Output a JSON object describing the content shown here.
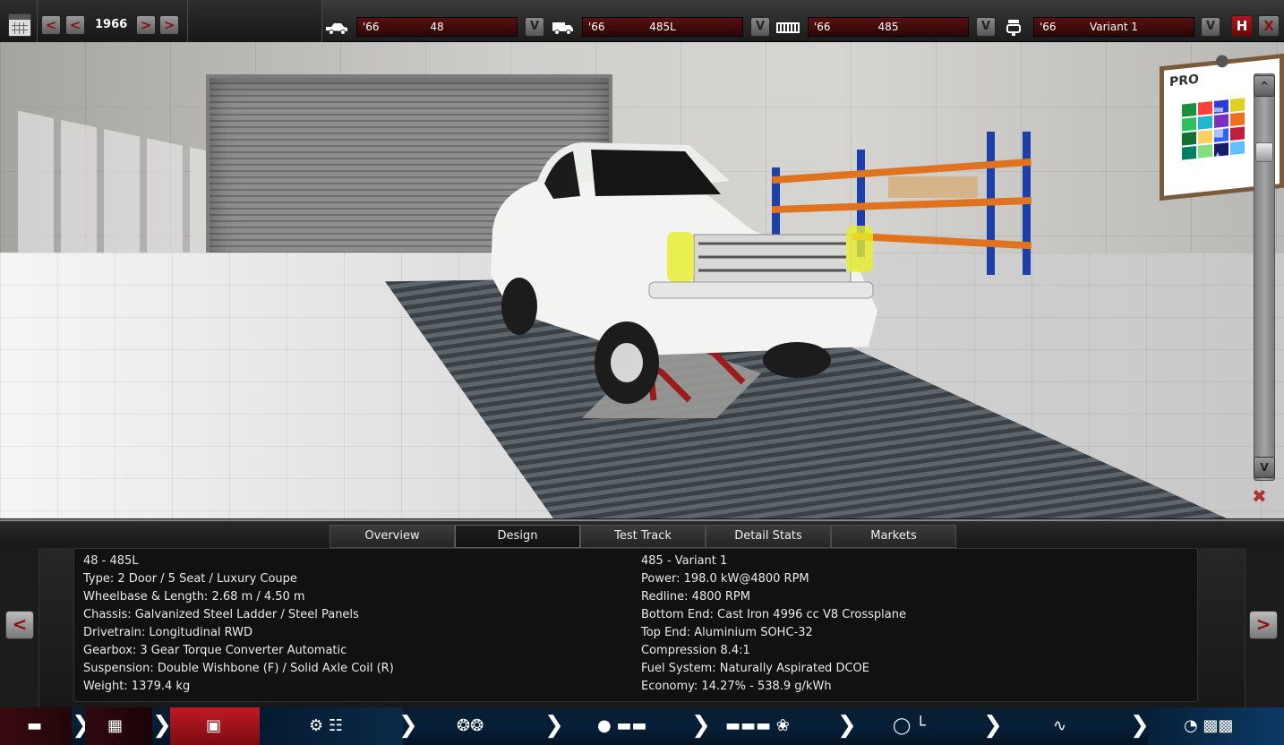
{
  "topbar": {
    "year": "1966",
    "prev_label": "<",
    "next_label": ">",
    "selectors": [
      {
        "icon": "car-model-icon",
        "year": "'66",
        "name": "48"
      },
      {
        "icon": "trim-icon",
        "year": "'66",
        "name": "485L"
      },
      {
        "icon": "engine-icon",
        "year": "'66",
        "name": "485"
      },
      {
        "icon": "engine-variant-icon",
        "year": "'66",
        "name": "Variant 1"
      }
    ],
    "dropdown_label": "V",
    "save_label": "H",
    "close_label": "X"
  },
  "scene": {
    "scroll_up": "^",
    "scroll_down": "V"
  },
  "tabs": [
    {
      "label": "Overview",
      "active": false
    },
    {
      "label": "Design",
      "active": true
    },
    {
      "label": "Test Track",
      "active": false
    },
    {
      "label": "Detail Stats",
      "active": false
    },
    {
      "label": "Markets",
      "active": false
    }
  ],
  "info": {
    "left": [
      "48 - 485L",
      "Type: 2 Door / 5 Seat / Luxury Coupe",
      "Wheelbase & Length: 2.68 m / 4.50 m",
      "Chassis: Galvanized Steel Ladder / Steel Panels",
      "Drivetrain: Longitudinal RWD",
      "Gearbox: 3 Gear Torque Converter Automatic",
      "Suspension: Double Wishbone (F) / Solid Axle Coil (R)",
      "Weight: 1379.4 kg"
    ],
    "right": [
      "485 - Variant 1",
      "Power: 198.0 kW@4800 RPM",
      "Redline: 4800 RPM",
      "Bottom End: Cast Iron 4996 cc V8 Crossplane",
      "Top End: Aluminium SOHC-32",
      "Compression 8.4:1",
      "Fuel System: Naturally Aspirated DCOE",
      "Economy: 14.27% - 538.9 g/kWh"
    ],
    "prev_label": "<",
    "next_label": ">"
  },
  "workflow": [
    {
      "icon": "model-icon",
      "active": false
    },
    {
      "icon": "chassis-icon",
      "active": false
    },
    {
      "icon": "trim-icon",
      "active": true
    },
    {
      "icon": "engine-gearbox-icon",
      "active": false
    },
    {
      "icon": "wheels-brakes-icon",
      "active": false
    },
    {
      "icon": "body-fixtures-icon",
      "active": false
    },
    {
      "icon": "aero-cooling-icon",
      "active": false
    },
    {
      "icon": "interior-icon",
      "active": false
    },
    {
      "icon": "suspension-icon",
      "active": false
    },
    {
      "icon": "test-finish-icon",
      "active": false
    }
  ],
  "colors": {
    "accent_red": "#8a1010",
    "workflow_active": "#a01018",
    "workflow_bg": "#062038"
  }
}
